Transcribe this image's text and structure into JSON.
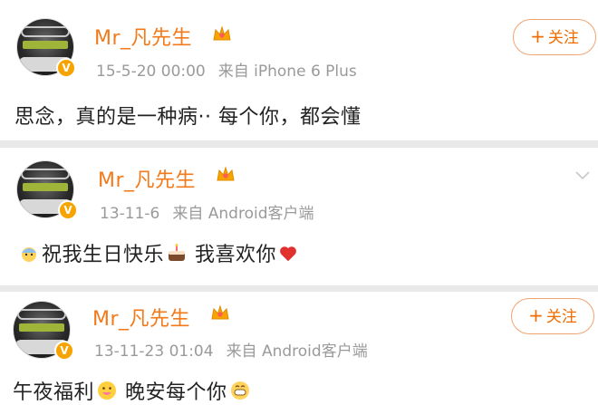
{
  "posts": [
    {
      "name": "Mr_凡先生",
      "time": "15-5-20 00:00",
      "source": "来自 iPhone 6 Plus",
      "action": "+ 关注",
      "text": "思念，真的是一种病·· 每个你，都会懂"
    },
    {
      "name": "Mr_凡先生",
      "time": "13-11-6",
      "source": "来自 Android客户端",
      "text_a": "祝我生日快乐",
      "text_b": "我喜欢你"
    },
    {
      "name": "Mr_凡先生",
      "time": "13-11-23 01:04",
      "source": "来自 Android客户端",
      "action": "+ 关注",
      "text_a": "午夜福利",
      "text_b": "晚安每个你"
    }
  ],
  "follow_label": "关注",
  "icons": {
    "verified": "verified-badge-icon",
    "crown": "crown-icon",
    "chevron": "chevron-down-icon",
    "emoji_baby": "baby-emoji-icon",
    "emoji_cake": "cake-emoji-icon",
    "emoji_heart": "heart-emoji-icon",
    "emoji_drool": "drool-emoji-icon",
    "emoji_grin": "grin-emoji-icon"
  },
  "colors": {
    "name": "#f27a1a",
    "meta": "#9a9a9a",
    "follow": "#f06c00",
    "verified": "#f7a400",
    "heart": "#e0312f"
  }
}
